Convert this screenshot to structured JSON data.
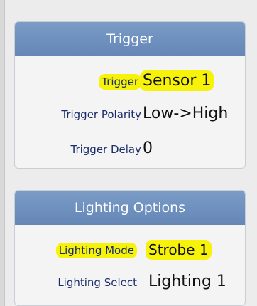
{
  "trigger_panel": {
    "title": "Trigger",
    "rows": [
      {
        "label": "Trigger",
        "value": "Sensor 1",
        "highlighted": true
      },
      {
        "label": "Trigger Polarity",
        "value": "Low->High",
        "highlighted": false
      },
      {
        "label": "Trigger Delay",
        "value": "0",
        "highlighted": false
      }
    ]
  },
  "lighting_panel": {
    "title": "Lighting Options",
    "rows": [
      {
        "label": "Lighting Mode",
        "value": "Strobe 1",
        "highlighted": true
      },
      {
        "label": "Lighting Select",
        "value": "Lighting 1",
        "highlighted": false
      }
    ]
  },
  "colors": {
    "header_blue": "#7195c2",
    "highlight_yellow": "#f7f20a",
    "label_navy": "#1a2c6b"
  }
}
